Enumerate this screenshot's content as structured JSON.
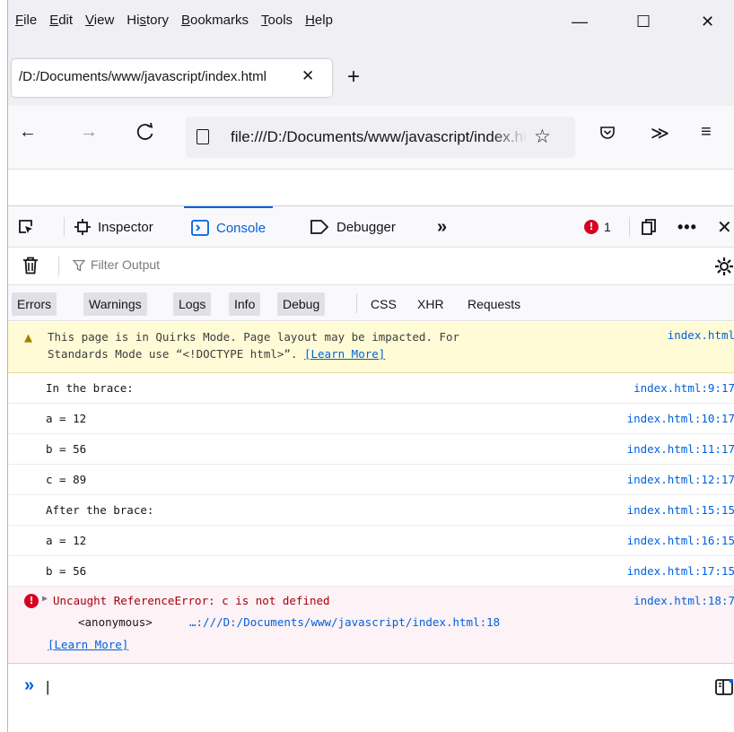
{
  "menu": {
    "items": [
      {
        "u": "F",
        "rest": "ile"
      },
      {
        "u": "E",
        "rest": "dit"
      },
      {
        "u": "V",
        "rest": "iew"
      },
      {
        "pre": "Hi",
        "u": "s",
        "rest": "tory"
      },
      {
        "u": "B",
        "rest": "ookmarks"
      },
      {
        "u": "T",
        "rest": "ools"
      },
      {
        "u": "H",
        "rest": "elp"
      }
    ],
    "labels": [
      "File",
      "Edit",
      "View",
      "History",
      "Bookmarks",
      "Tools",
      "Help"
    ]
  },
  "window_controls": {
    "minimize": "—",
    "maximize": "☐",
    "close": "✕"
  },
  "tab": {
    "title": "/D:/Documents/www/javascript/index.html",
    "close": "✕",
    "new_tab": "+"
  },
  "nav": {
    "back": "←",
    "forward": "→",
    "reload": "C",
    "url": "file:///D:/Documents/www/javascript/index.html",
    "star": "☆",
    "more": "≫",
    "menu": "≡"
  },
  "devtools": {
    "tabs": {
      "inspector": "Inspector",
      "console": "Console",
      "debugger": "Debugger",
      "overflow": "»"
    },
    "error_count": "1",
    "filter_placeholder": "Filter Output",
    "categories": [
      "Errors",
      "Warnings",
      "Logs",
      "Info",
      "Debug"
    ],
    "extra_categories": [
      "CSS",
      "XHR",
      "Requests"
    ]
  },
  "messages": {
    "warning": {
      "line1": "This page is in Quirks Mode. Page layout may be impacted. For",
      "line2": "Standards Mode use “<!DOCTYPE html>”. ",
      "learn": "[Learn More]",
      "loc": "index.html"
    },
    "logs": [
      {
        "text": "In the brace:",
        "loc": "index.html:9:17"
      },
      {
        "text": "a = 12",
        "loc": "index.html:10:17"
      },
      {
        "text": "b = 56",
        "loc": "index.html:11:17"
      },
      {
        "text": "c = 89",
        "loc": "index.html:12:17"
      },
      {
        "text": "After the brace:",
        "loc": "index.html:15:15"
      },
      {
        "text": "a = 12",
        "loc": "index.html:16:15"
      },
      {
        "text": "b = 56",
        "loc": "index.html:17:15"
      }
    ],
    "error": {
      "text": "Uncaught ReferenceError: c is not defined",
      "loc": "index.html:18:7",
      "frame_name": "<anonymous>",
      "frame_loc": "…:///D:/Documents/www/javascript/index.html:18",
      "learn": "[Learn More]"
    }
  },
  "prompt": {
    "chevron": "»",
    "caret": "|"
  },
  "colors": {
    "accent": "#0060df",
    "error": "#d70022",
    "warning_bg": "#fffbd6",
    "error_bg": "#fdf2f5"
  }
}
